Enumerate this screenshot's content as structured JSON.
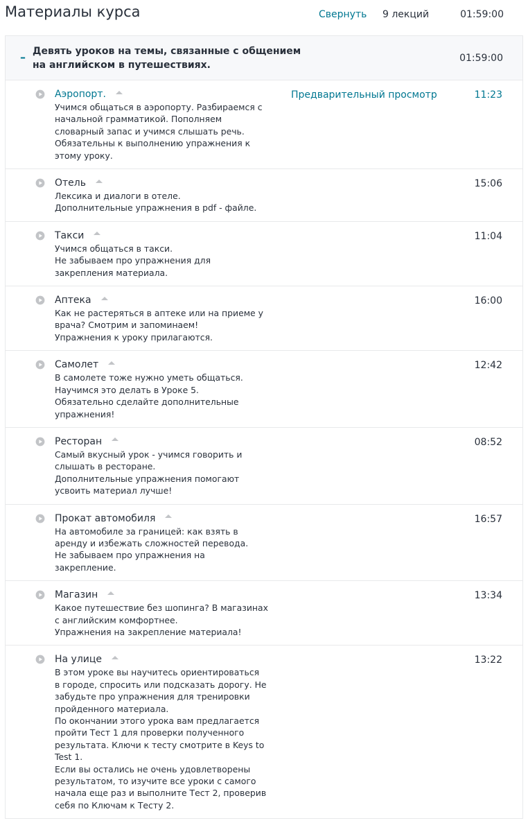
{
  "header": {
    "title": "Материалы курса",
    "collapse_label": "Свернуть",
    "lecture_count": "9 лекций",
    "total_duration": "01:59:00"
  },
  "section": {
    "toggle": "–",
    "title": "Девять уроков на темы, связанные с общением на английском в путешествиях.",
    "duration": "01:59:00"
  },
  "lectures": [
    {
      "title": "Аэропорт.",
      "description": "Учимся общаться в аэропорту. Разбираемся с\nначальной грамматикой. Пополняем\nсловарный запас и учимся слышать речь.\nОбязательны к выполнению упражнения к\nэтому уроку.",
      "preview": "Предварительный просмотр",
      "duration": "11:23"
    },
    {
      "title": "Отель",
      "description": "Лексика и диалоги в отеле.\nДополнительные упражнения в pdf - файле.",
      "duration": "15:06"
    },
    {
      "title": "Такси",
      "description": "Учимся общаться в такси.\nНе забываем про упражнения для\nзакрепления материала.",
      "duration": "11:04"
    },
    {
      "title": "Аптека",
      "description": "Как не растеряться в аптеке или на приеме у\nврача? Смотрим и запоминаем!\nУпражнения к уроку прилагаются.",
      "duration": "16:00"
    },
    {
      "title": "Самолет",
      "description": "В самолете тоже нужно уметь общаться.\nНаучимся это делать в Уроке 5.\nОбязательно сделайте дополнительные\nупражнения!",
      "duration": "12:42"
    },
    {
      "title": "Ресторан",
      "description": "Самый вкусный урок - учимся говорить и\nслышать в ресторане.\nДополнительные упражнения помогают\nусвоить материал лучше!",
      "duration": "08:52"
    },
    {
      "title": "Прокат автомобиля",
      "description": "На автомобиле за границей: как взять в\nаренду и избежать сложностей перевода.\nНе забываем про упражнения на\nзакрепление.",
      "duration": "16:57"
    },
    {
      "title": "Магазин",
      "description": "Какое путешествие без шопинга? В магазинах\nс английским комфортнее.\nУпражнения на закрепление материала!",
      "duration": "13:34"
    },
    {
      "title": "На улице",
      "description": "В этом уроке вы научитесь ориентироваться\nв городе, спросить или подсказать дорогу.  Не\nзабудьте про упражнения для тренировки\nпройденного материала.\nПо окончании этого урока вам предлагается\nпройти Тест 1 для проверки полученного\nрезультата. Ключи к тесту смотрите в Keys to\nTest 1.\nЕсли вы остались не очень удовлетворены\nрезультатом, то изучите все уроки с самого\nначала еще раз и выполните Тест 2, проверив\nсебя по Ключам к Тесту 2.",
      "duration": "13:22"
    }
  ],
  "colors": {
    "link": "#007791",
    "text": "#29303b",
    "border": "#e8e9eb",
    "section_bg": "#f7f8fa",
    "icon": "#c2c4c7"
  },
  "icons": {
    "play": "play-circle-icon",
    "caret": "caret-up-icon"
  }
}
